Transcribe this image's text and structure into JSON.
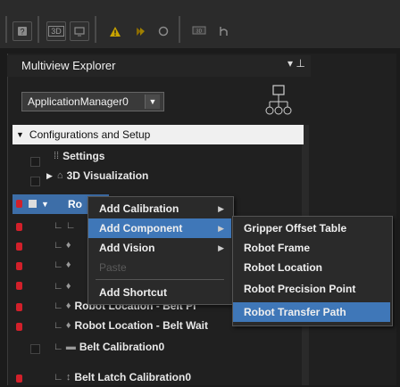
{
  "toolbar": {
    "icons": [
      "help-icon",
      "3d-view-icon",
      "warning-icon",
      "build-icon",
      "refresh-icon",
      "monitor-icon",
      "custom-icon"
    ],
    "view3d_label": "3D"
  },
  "explorer": {
    "title": "Multiview Explorer",
    "pin_glyph": "▾ ⊥",
    "controller": "ApplicationManager0"
  },
  "tree": {
    "root": "Configurations and Setup",
    "settings": "Settings",
    "visualization": "3D Visualization",
    "robot_partial": "Ro",
    "location_belt_pick": "Robot Location - Belt Pi",
    "location_belt_wait": "Robot Location - Belt Wait",
    "belt_calibration": "Belt Calibration0",
    "belt_latch": "Belt Latch Calibration0"
  },
  "context_menu": {
    "items": [
      "Add Calibration",
      "Add Component",
      "Add Vision",
      "Paste",
      "Add Shortcut"
    ],
    "active": "Add Component",
    "disabled": "Paste"
  },
  "submenu": {
    "items": [
      "Gripper Offset Table",
      "Robot Frame",
      "Robot Location",
      "Robot Precision Point",
      "Robot Transfer Path"
    ],
    "highlighted": "Robot Transfer Path"
  },
  "colors": {
    "accent": "#3f77b8",
    "error": "#d2202a",
    "warning": "#e0b000"
  }
}
